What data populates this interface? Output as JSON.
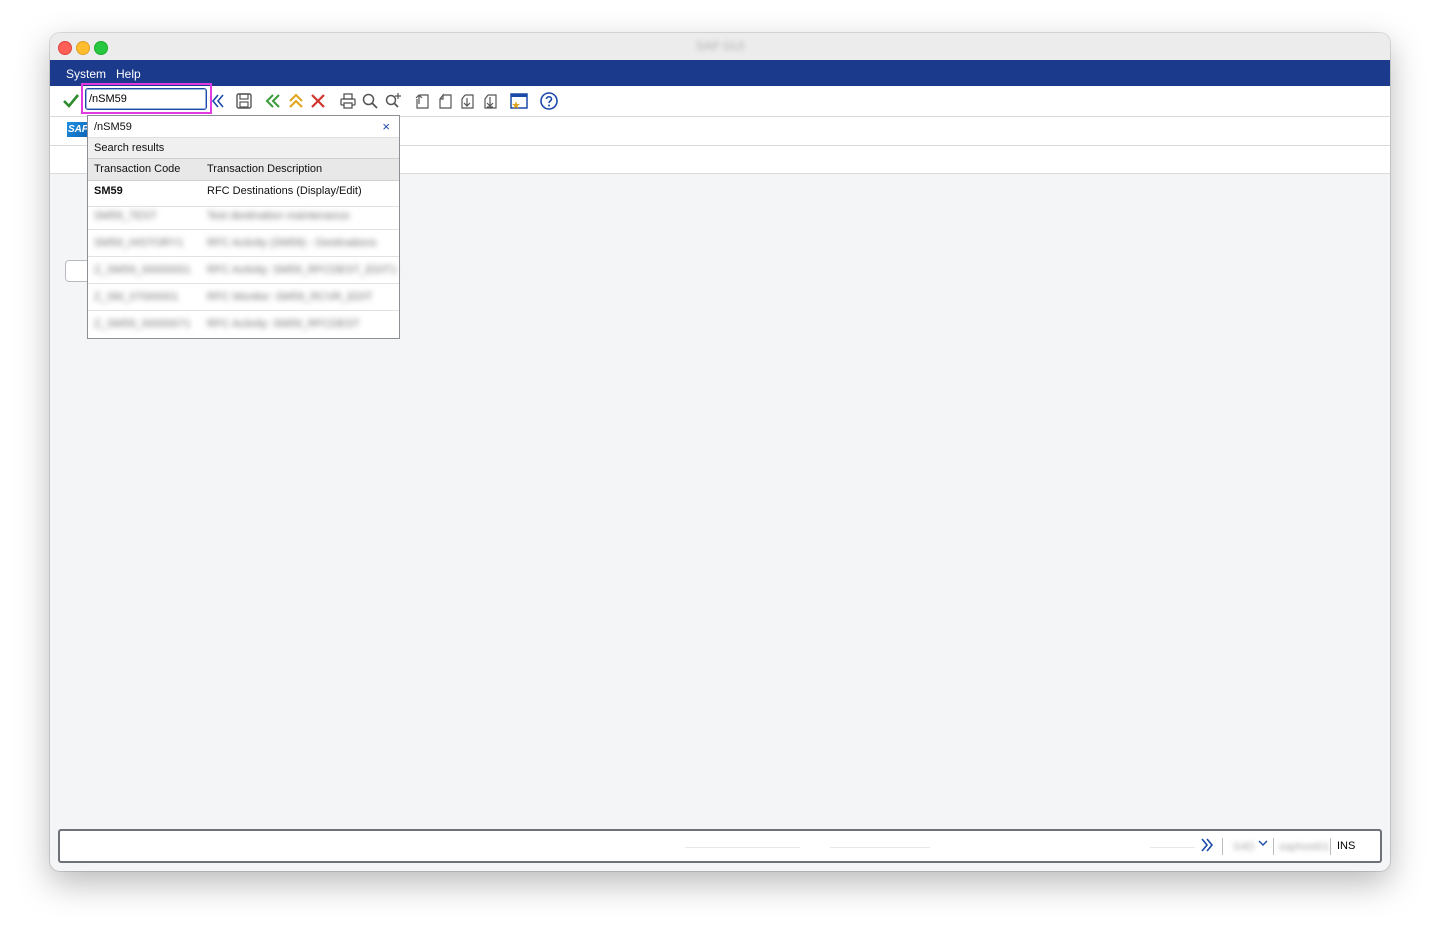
{
  "window": {
    "title": "SAP GUI"
  },
  "menubar": {
    "items": [
      {
        "label": "System"
      },
      {
        "label": "Help"
      }
    ]
  },
  "toolbar": {
    "command_field_value": "/nSM59",
    "icons": [
      "enter-checkmark-icon",
      "expand-history-icon",
      "save-icon",
      "back-icon",
      "exit-icon",
      "cancel-icon",
      "print-icon",
      "find-icon",
      "find-next-icon",
      "first-page-icon",
      "previous-page-icon",
      "next-page-icon",
      "last-page-icon",
      "create-session-icon",
      "help-icon"
    ],
    "colors": {
      "check": "#2e8b2e",
      "back": "#3a9b3a",
      "exit": "#e0a21a",
      "cancel": "#d0342c",
      "blue": "#1b4aa8"
    }
  },
  "dropdown": {
    "input_echo": "/nSM59",
    "close_symbol": "×",
    "section_label": "Search results",
    "columns": [
      "Transaction Code",
      "Transaction Description"
    ],
    "rows": [
      {
        "code": "SM59",
        "description": "RFC Destinations (Display/Edit)",
        "blurred": false
      },
      {
        "code": "SM59_TEST",
        "description": "Test destination maintenance",
        "blurred": true
      },
      {
        "code": "SM59_HISTORY1",
        "description": "RFC Activity (SM59) - Destinations",
        "blurred": true
      },
      {
        "code": "Z_SM59_00000001",
        "description": "RFC Activity: SM59_RFCDEST_EDIT1",
        "blurred": true
      },
      {
        "code": "Z_SM_07000001",
        "description": "RFC Monitor: SM59_RCVR_EDIT",
        "blurred": true
      },
      {
        "code": "Z_SM59_00000071",
        "description": "RFC Activity: SM59_RFCDEST",
        "blurred": true
      }
    ]
  },
  "statusbar": {
    "system": "S4D",
    "server": "saphost01",
    "mode": "INS"
  },
  "colors": {
    "menubar_bg": "#1b3a8c",
    "highlight": "#e03ae0"
  }
}
